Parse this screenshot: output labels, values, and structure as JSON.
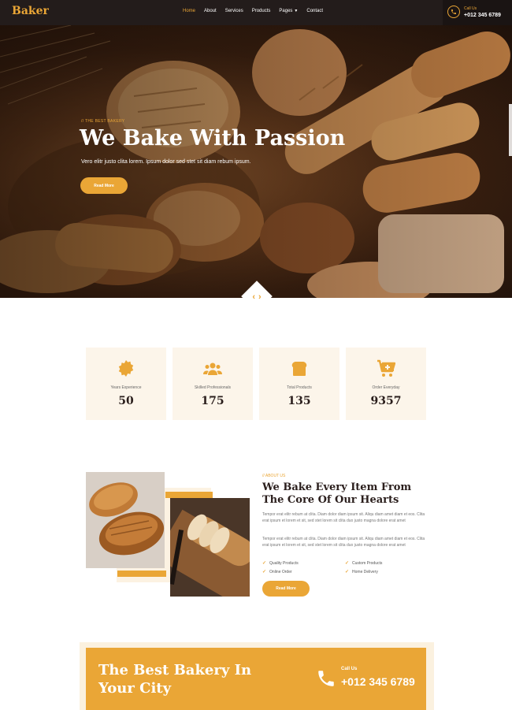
{
  "brand": "Baker",
  "nav": {
    "links": [
      "Home",
      "About",
      "Services",
      "Products",
      "Pages",
      "Contact"
    ],
    "active": "Home",
    "call_label": "Call Us",
    "call_number": "+012 345 6789"
  },
  "hero": {
    "tag": "// THE BEST BAKERY",
    "title": "We Bake With Passion",
    "subtitle": "Vero elitr justo clita lorem. Ipsum dolor sed stet sit diam rebum ipsum.",
    "button": "Read More"
  },
  "facts": [
    {
      "icon": "certificate-icon",
      "label": "Years Experience",
      "value": "50"
    },
    {
      "icon": "users-icon",
      "label": "Skilled Professionals",
      "value": "175"
    },
    {
      "icon": "bread-icon",
      "label": "Total Products",
      "value": "135"
    },
    {
      "icon": "cart-plus-icon",
      "label": "Order Everyday",
      "value": "9357"
    }
  ],
  "about": {
    "tag": "// ABOUT US",
    "title": "We Bake Every Item From The Core Of Our Hearts",
    "paragraph1": "Tempor erat elitr rebum at clita. Diam dolor diam ipsum sit. Aliqu diam amet diam et eos. Clita erat ipsum et lorem et sit, sed stet lorem sit clita duo justo magna dolore erat amet",
    "paragraph2": "Tempor erat elitr rebum at clita. Diam dolor diam ipsum sit. Aliqu diam amet diam et eos. Clita erat ipsum et lorem et sit, sed stet lorem sit clita duo justo magna dolore erat amet",
    "checks": [
      "Quality Products",
      "Custom Products",
      "Online Order",
      "Home Delivery"
    ],
    "button": "Read More"
  },
  "cta": {
    "title": "The Best Bakery In Your City",
    "call_label": "Call Us",
    "call_number": "+012 345 6789"
  },
  "colors": {
    "accent": "#eaa636",
    "dark": "#231c1b",
    "cream": "#fcf5ea"
  }
}
